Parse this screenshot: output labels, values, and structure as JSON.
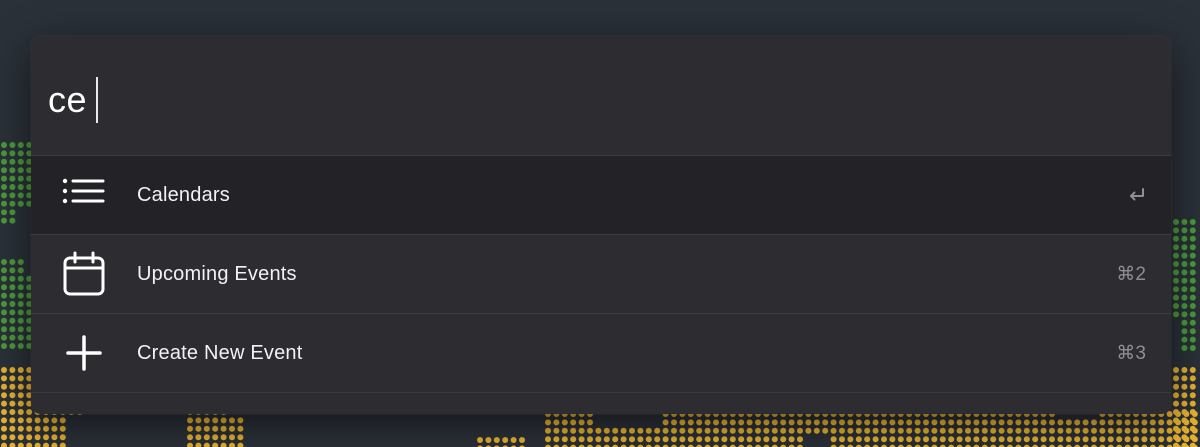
{
  "search": {
    "query": "ce"
  },
  "results": [
    {
      "label": "Calendars",
      "icon": "list-icon",
      "shortcut": "↩",
      "selected": true
    },
    {
      "label": "Upcoming Events",
      "icon": "calendar-icon",
      "shortcut": "⌘2",
      "selected": false
    },
    {
      "label": "Create New Event",
      "icon": "plus-icon",
      "shortcut": "⌘3",
      "selected": false
    }
  ],
  "colors": {
    "background": "#2b3139",
    "panel": "#2c2c31",
    "selected_row": "#232327",
    "map_green": "#4a9b3a",
    "map_yellow": "#e8b22e"
  }
}
